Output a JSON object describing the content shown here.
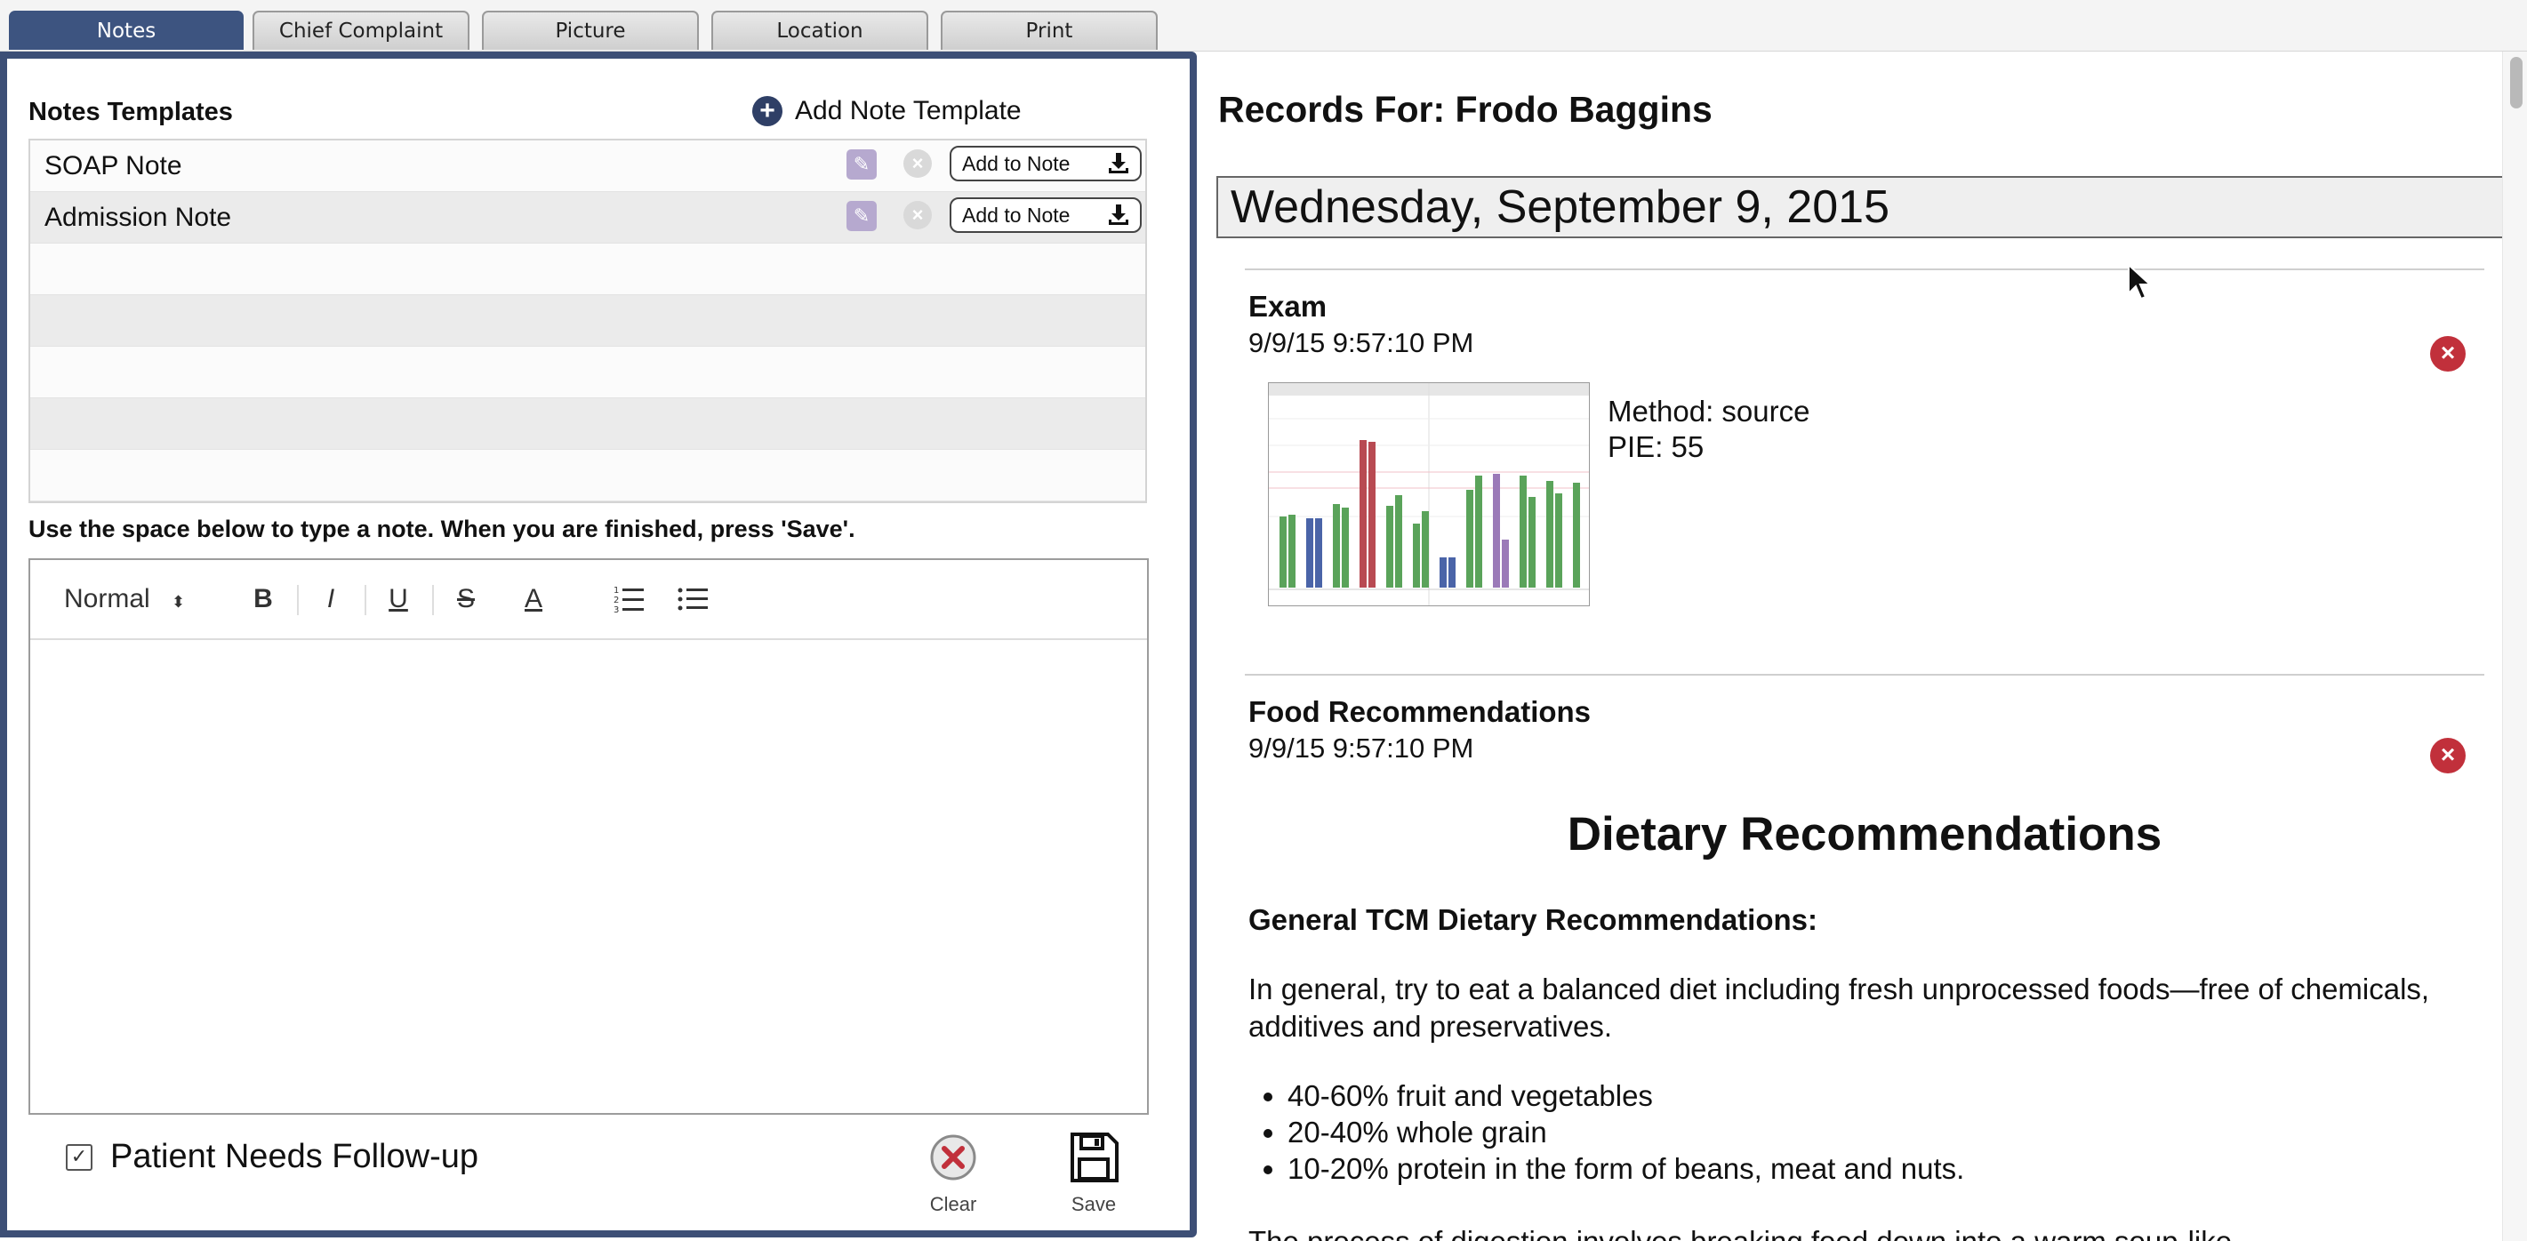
{
  "tabs": [
    {
      "label": "Notes",
      "active": true
    },
    {
      "label": "Chief Complaint",
      "active": false
    },
    {
      "label": "Picture",
      "active": false
    },
    {
      "label": "Location",
      "active": false
    },
    {
      "label": "Print",
      "active": false
    }
  ],
  "notes_panel": {
    "templates_title": "Notes Templates",
    "add_template_label": "Add Note Template",
    "templates": [
      {
        "name": "SOAP Note",
        "add_label": "Add to Note"
      },
      {
        "name": "Admission Note",
        "add_label": "Add to Note"
      }
    ],
    "instructions": "Use the space below to type a note.  When you are finished, press 'Save'.",
    "editor": {
      "format_select": "Normal",
      "buttons": [
        "B",
        "I",
        "U",
        "S",
        "A"
      ],
      "content": ""
    },
    "followup_label": "Patient Needs Follow-up",
    "followup_checked": true,
    "clear_label": "Clear",
    "save_label": "Save"
  },
  "records": {
    "title": "Records For: Frodo Baggins",
    "date": "Wednesday, September 9, 2015",
    "entries": [
      {
        "title": "Exam",
        "timestamp": "9/9/15 9:57:10 PM",
        "method": "Method: source",
        "pie": "PIE: 55"
      },
      {
        "title": "Food Recommendations",
        "timestamp": "9/9/15 9:57:10 PM",
        "heading": "Dietary Recommendations",
        "subheading": "General TCM Dietary Recommendations:",
        "paragraph": "In general, try to eat a balanced diet including fresh unprocessed foods—free of chemicals, additives and preservatives.",
        "bullets": [
          "40-60% fruit and vegetables",
          "20-40% whole grain",
          "10-20% protein in the form of beans, meat and nuts."
        ],
        "trailing_text": "The process of digestion involves breaking food down into a warm soup-like"
      }
    ]
  },
  "colors": {
    "active_tab": "#3d5480",
    "panel_border": "#3d4f76",
    "delete_red": "#c1303b",
    "bar_green": "#5aa35a",
    "bar_blue": "#4a64a8",
    "bar_red": "#b84a52",
    "bar_purple": "#9b7ab8"
  },
  "icons": {
    "add_template": "plus-circle-icon",
    "edit": "pencil-icon",
    "delete_template": "x-circle-icon",
    "add_to_note": "download-icon",
    "clear": "x-circle-icon",
    "save": "floppy-disk-icon",
    "remove_record": "x-circle-icon"
  }
}
